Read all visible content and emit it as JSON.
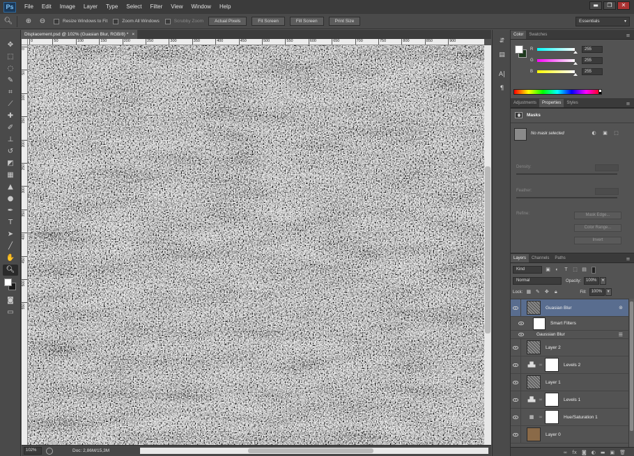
{
  "app": {
    "logo": "Ps"
  },
  "menu": [
    "File",
    "Edit",
    "Image",
    "Layer",
    "Type",
    "Select",
    "Filter",
    "View",
    "Window",
    "Help"
  ],
  "window_controls": {
    "minimize": "▬",
    "restore": "❐",
    "close": "✕"
  },
  "options_bar": {
    "resize_windows_label": "Resize Windows to Fit",
    "zoom_all_label": "Zoom All Windows",
    "scrubby_zoom_label": "Scrubby Zoom",
    "actual_pixels_label": "Actual Pixels",
    "fit_screen_label": "Fit Screen",
    "fill_screen_label": "Fill Screen",
    "print_size_label": "Print Size",
    "workspace": "Essentials"
  },
  "document": {
    "tab_title": "Displacement.psd @ 102% (Guasian Blur, RGB/8) *",
    "tab_close": "×",
    "ruler_h_labels": [
      "0",
      "50",
      "100",
      "150",
      "200",
      "250",
      "300",
      "350",
      "400",
      "450",
      "500",
      "550",
      "600",
      "650",
      "700",
      "750",
      "800",
      "850",
      "900"
    ],
    "ruler_v_labels": [
      "0",
      "50",
      "100",
      "150",
      "200",
      "250",
      "300",
      "350",
      "400",
      "450",
      "500",
      "550"
    ],
    "zoom": "102%",
    "doc_info": "Doc: 2,86M/15,3M"
  },
  "color_panel": {
    "tabs": [
      "Color",
      "Swatches"
    ],
    "channels": [
      {
        "label": "R",
        "value": "255",
        "gradient": "linear-gradient(to right,#00ffff,#ffffff)"
      },
      {
        "label": "G",
        "value": "255",
        "gradient": "linear-gradient(to right,#ff00ff,#ffffff)"
      },
      {
        "label": "B",
        "value": "255",
        "gradient": "linear-gradient(to right,#ffff00,#ffffff)"
      }
    ],
    "foreground": "#ffffff",
    "background": "#1e3a1e"
  },
  "properties_panel": {
    "tabs": [
      "Adjustments",
      "Properties",
      "Styles"
    ],
    "title": "Masks",
    "no_mask": "No mask selected",
    "density_label": "Density:",
    "feather_label": "Feather:",
    "refine_label": "Refine:",
    "mask_edge_label": "Mask Edge...",
    "color_range_label": "Color Range...",
    "invert_label": "Invert"
  },
  "layers_panel": {
    "tabs": [
      "Layers",
      "Channels",
      "Paths"
    ],
    "filter_kind": "Kind",
    "blend_mode": "Normal",
    "opacity_label": "Opacity:",
    "opacity_value": "100%",
    "lock_label": "Lock:",
    "fill_label": "Fill:",
    "fill_value": "100%",
    "layers": [
      {
        "name": "Guasian Blur",
        "thumb": "noise",
        "selected": true
      },
      {
        "name": "Smart Filters",
        "thumb": "white"
      },
      {
        "name": "Gaussian Blur"
      },
      {
        "name": "Layer 2",
        "thumb": "noise"
      },
      {
        "name": "Levels 2",
        "thumb": "white",
        "icon": "levels-icon"
      },
      {
        "name": "Layer 1",
        "thumb": "noise"
      },
      {
        "name": "Levels 1",
        "thumb": "white",
        "icon": "levels-icon"
      },
      {
        "name": "Hue/Saturation 1",
        "thumb": "white",
        "icon": "hue-saturation-icon"
      },
      {
        "name": "Layer 0",
        "thumb": "brown"
      }
    ]
  }
}
